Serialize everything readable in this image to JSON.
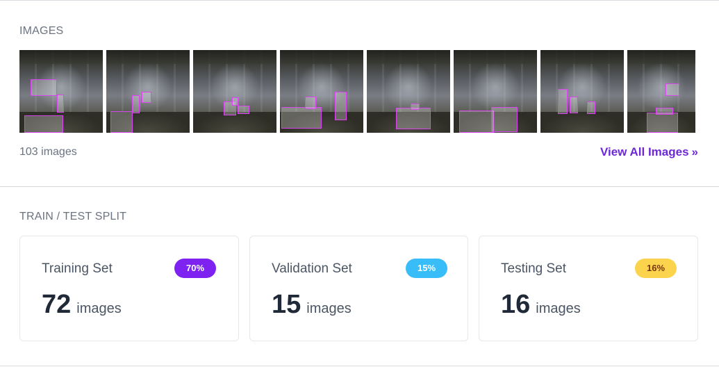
{
  "images_section": {
    "title": "IMAGES",
    "count_text": "103 images",
    "view_all_label": "View All Images",
    "view_all_icon": "double-chevron-right-icon",
    "thumbnails": [
      {
        "boxes": 3
      },
      {
        "boxes": 3
      },
      {
        "boxes": 3
      },
      {
        "boxes": 3
      },
      {
        "boxes": 2
      },
      {
        "boxes": 2
      },
      {
        "boxes": 3
      },
      {
        "boxes": 3
      }
    ]
  },
  "split_section": {
    "title": "TRAIN / TEST SPLIT",
    "sets": [
      {
        "name": "Training Set",
        "percent": "70%",
        "count": "72",
        "unit": "images",
        "badge_bg": "#7e22f2",
        "badge_fg": "#ffffff"
      },
      {
        "name": "Validation Set",
        "percent": "15%",
        "count": "15",
        "unit": "images",
        "badge_bg": "#38bdf8",
        "badge_fg": "#ffffff"
      },
      {
        "name": "Testing Set",
        "percent": "16%",
        "count": "16",
        "unit": "images",
        "badge_bg": "#fcd34d",
        "badge_fg": "#78350f"
      }
    ]
  },
  "colors": {
    "accent": "#6d28d9",
    "annotation_box": "#d946ef"
  }
}
